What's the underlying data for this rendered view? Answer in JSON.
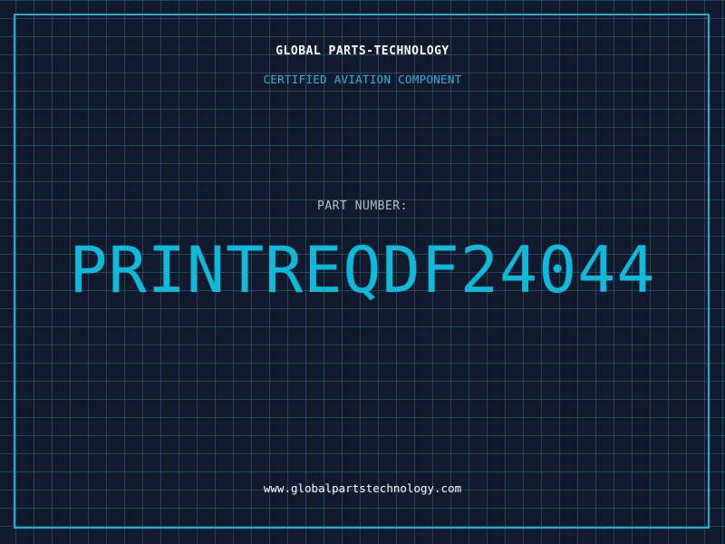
{
  "header": {
    "brand": "GLOBAL PARTS-TECHNOLOGY",
    "tagline": "CERTIFIED AVIATION COMPONENT"
  },
  "part": {
    "label": "PART NUMBER:",
    "number": "PRINTREQDF24044"
  },
  "footer": {
    "url": "www.globalpartstechnology.com"
  },
  "colors": {
    "background": "#111a2c",
    "grid": "#3c8caa",
    "accent": "#1fb0d6",
    "part_number": "#10b8da"
  }
}
